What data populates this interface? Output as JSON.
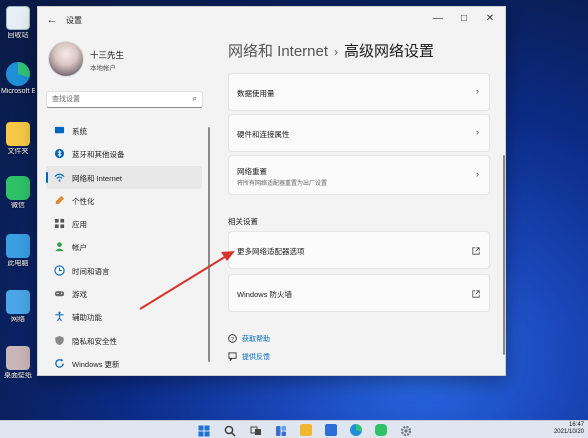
{
  "desktop": {
    "icons": [
      {
        "label": "回收站",
        "icon": "recycle-bin-icon",
        "color": "#e8eef5"
      },
      {
        "label": "Microsoft Edge",
        "icon": "edge-icon",
        "color": "#1f8fd8"
      },
      {
        "label": "文件夹",
        "icon": "folder-icon",
        "color": "#f6c846"
      },
      {
        "label": "微信",
        "icon": "wechat-icon",
        "color": "#2ec166"
      },
      {
        "label": "此电脑",
        "icon": "this-pc-icon",
        "color": "#3a9ee0"
      },
      {
        "label": "网络",
        "icon": "network-icon",
        "color": "#4aa6e6"
      },
      {
        "label": "桌面壁纸",
        "icon": "wallpaper-icon",
        "color": "#c9b6b8"
      }
    ]
  },
  "window": {
    "title": "设置",
    "controls": {
      "minimize": "—",
      "maximize": "☐",
      "close": "✕"
    },
    "back": "←"
  },
  "profile": {
    "name": "十三先生",
    "account_type": "本地帐户"
  },
  "search": {
    "placeholder": "查找设置"
  },
  "sidebar": {
    "items": [
      {
        "label": "系统",
        "icon": "display-icon",
        "color": "#0067c0"
      },
      {
        "label": "蓝牙和其他设备",
        "icon": "bluetooth-icon",
        "color": "#0067c0"
      },
      {
        "label": "网络和 Internet",
        "icon": "wifi-icon",
        "color": "#0067c0",
        "active": true
      },
      {
        "label": "个性化",
        "icon": "brush-icon",
        "color": "#e08a2e"
      },
      {
        "label": "应用",
        "icon": "apps-icon",
        "color": "#555555"
      },
      {
        "label": "帐户",
        "icon": "account-icon",
        "color": "#2ea043"
      },
      {
        "label": "时间和语言",
        "icon": "globe-clock-icon",
        "color": "#0067c0"
      },
      {
        "label": "游戏",
        "icon": "gamepad-icon",
        "color": "#666666"
      },
      {
        "label": "辅助功能",
        "icon": "accessibility-icon",
        "color": "#1b6fc4"
      },
      {
        "label": "隐私和安全性",
        "icon": "shield-icon",
        "color": "#777777"
      },
      {
        "label": "Windows 更新",
        "icon": "update-icon",
        "color": "#0067c0"
      }
    ]
  },
  "breadcrumb": {
    "parent": "网络和 Internet",
    "separator": "›",
    "current": "高级网络设置"
  },
  "cards": [
    {
      "title": "数据使用量",
      "subtitle": "",
      "action": "›"
    },
    {
      "title": "硬件和连接属性",
      "subtitle": "",
      "action": "›"
    },
    {
      "title": "网络重置",
      "subtitle": "将所有网络适配器重置为出厂设置",
      "action": "›"
    }
  ],
  "related": {
    "heading": "相关设置",
    "items": [
      {
        "title": "更多网络适配器选项",
        "action": "external-link-icon"
      },
      {
        "title": "Windows 防火墙",
        "action": "external-link-icon"
      }
    ]
  },
  "footer_links": [
    {
      "label": "获取帮助",
      "icon": "help-icon"
    },
    {
      "label": "提供反馈",
      "icon": "feedback-icon"
    }
  ],
  "taskbar": {
    "icons": [
      {
        "icon": "start-icon",
        "color": "#1e73d6"
      },
      {
        "icon": "search-icon",
        "color": "#333333"
      },
      {
        "icon": "task-view-icon",
        "color": "#444444"
      },
      {
        "icon": "widgets-icon",
        "color": "#3a6fd0"
      },
      {
        "icon": "file-explorer-icon",
        "color": "#f2b631"
      },
      {
        "icon": "store-icon",
        "color": "#2b6fd6"
      },
      {
        "icon": "edge-icon",
        "color": "#1f8fd8"
      },
      {
        "icon": "wechat-icon",
        "color": "#2ec166"
      },
      {
        "icon": "settings-icon",
        "color": "#6b7280"
      }
    ],
    "time": "16:47",
    "date": "2021/10/20"
  },
  "accent_color": "#0067c0",
  "annotation_color": "#d9342b"
}
